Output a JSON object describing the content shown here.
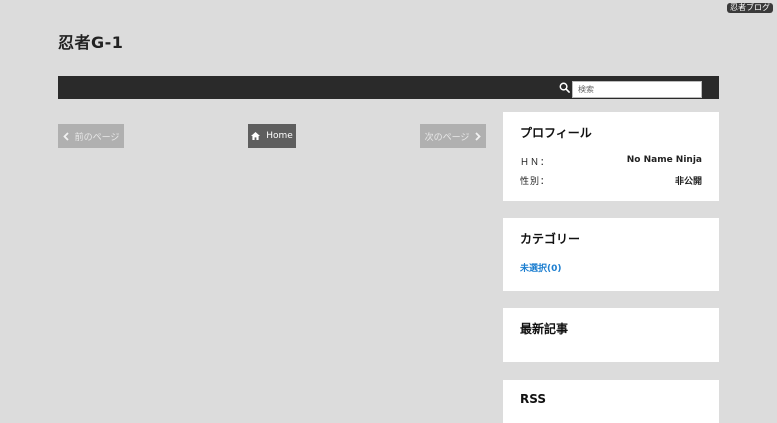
{
  "corner_badge": "忍者ブログ",
  "site_title": "忍者G-1",
  "search": {
    "placeholder": "検索"
  },
  "pager": {
    "prev_label": "前のページ",
    "home_label": "Home",
    "next_label": "次のページ"
  },
  "sidebar": {
    "profile": {
      "title": "プロフィール",
      "rows": [
        {
          "key": "ＨＮ：",
          "value": "No Name Ninja"
        },
        {
          "key": "性別：",
          "value": "非公開"
        }
      ]
    },
    "category": {
      "title": "カテゴリー",
      "link": "未選択(0)"
    },
    "recent": {
      "title": "最新記事"
    },
    "rss": {
      "title": "RSS"
    }
  },
  "colors": {
    "background": "#dcdcdc",
    "navbar": "#2a2a2a",
    "link": "#1e7fd0"
  }
}
